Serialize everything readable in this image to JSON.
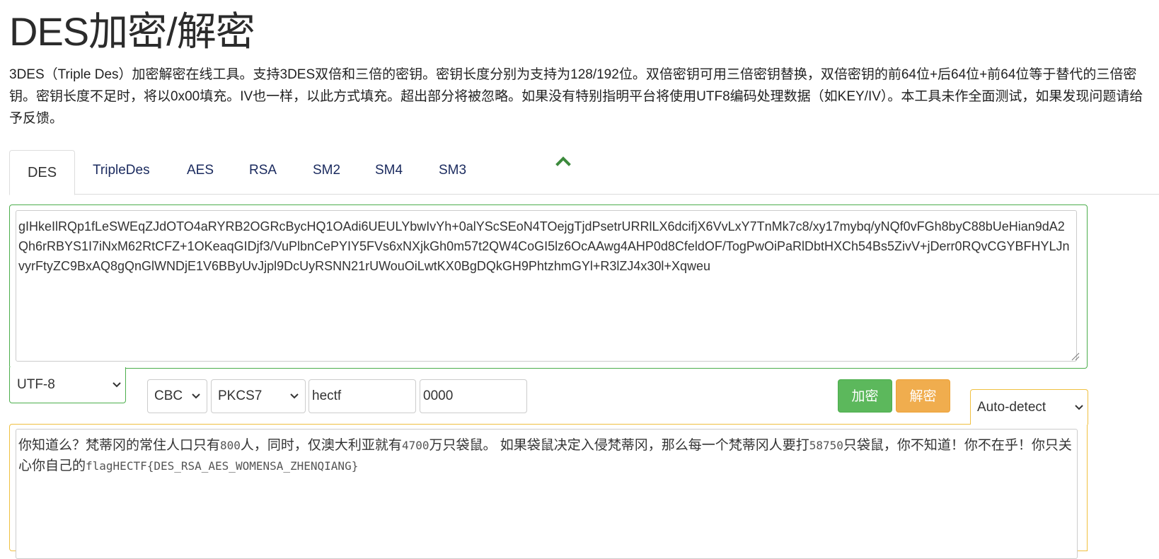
{
  "page": {
    "title": "DES加密/解密",
    "description": "3DES（Triple Des）加密解密在线工具。支持3DES双倍和三倍的密钥。密钥长度分别为支持为128/192位。双倍密钥可用三倍密钥替换，双倍密钥的前64位+后64位+前64位等于替代的三倍密钥。密钥长度不足时，将以0x00填充。IV也一样，以此方式填充。超出部分将被忽略。如果没有特别指明平台将使用UTF8编码处理数据（如KEY/IV）。本工具未作全面测试，如果发现问题请给予反馈。"
  },
  "tabs": [
    {
      "label": "DES",
      "active": true
    },
    {
      "label": "TripleDes"
    },
    {
      "label": "AES"
    },
    {
      "label": "RSA"
    },
    {
      "label": "SM2"
    },
    {
      "label": "SM4"
    },
    {
      "label": "SM3"
    }
  ],
  "input": {
    "text": "gIHkeIlRQp1fLeSWEqZJdOTO4aRYRB2OGRcBycHQ1OAdi6UEULYbwIvYh+0alYScSEoN4TOejgTjdPsetrURRlLX6dcifjX6VvLxY7TnMk7c8/xy17mybq/yNQf0vFGh8byC88bUeHian9dA2Qh6rRBYS1I7iNxM62RtCFZ+1OKeaqGIDjf3/VuPlbnCePYIY5FVs6xNXjkGh0m57t2QW4CoGI5lz6OcAAwg4AHP0d8CfeldOF/TogPwOiPaRlDbtHXCh54Bs5ZivV+jDerr0RQvCGYBFHYLJnvyrFtyZC9BxAQ8gQnGlWNDjE1V6BByUvJjpl9DcUyRSNN21rUWouOiLwtKX0BgDQkGH9PhtzhmGYl+R3lZJ4x30l+Xqweu"
  },
  "controls": {
    "encoding": "UTF-8",
    "mode": "CBC",
    "padding": "PKCS7",
    "key": "hectf",
    "iv": "0000",
    "encrypt_label": "加密",
    "decrypt_label": "解密",
    "output_encoding": "Auto-detect"
  },
  "output": {
    "text_plain": "你知道么？梵蒂冈的常住人口只有",
    "num1": "800",
    "text2": "人，同时，仅澳大利亚就有",
    "num2": "4700",
    "text3": "万只袋鼠。 如果袋鼠决定入侵梵蒂冈，那么每一个梵蒂冈人要打",
    "num3": "58750",
    "text4": "只袋鼠，你不知道！你不在乎！你只关心你自己的",
    "flag": "flagHECTF{DES_RSA_AES_WOMENSA_ZHENQIANG}"
  },
  "colors": {
    "encrypt": "#5cb85c",
    "decrypt": "#f0ad4e",
    "input_panel_border": "#4cae4c",
    "output_panel_border": "#f0c040",
    "collapse_icon": "#3c8a3c"
  }
}
